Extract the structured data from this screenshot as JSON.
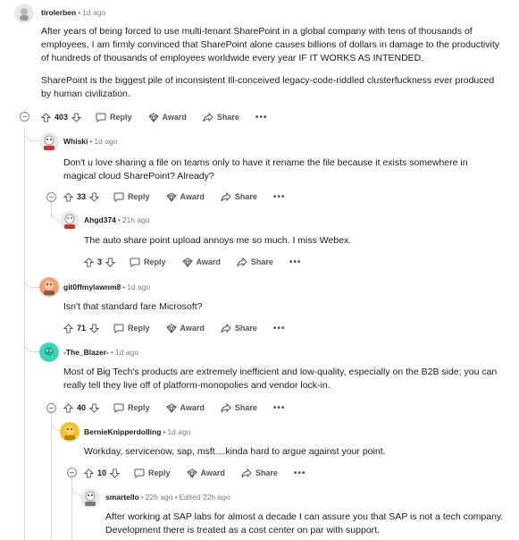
{
  "comments": [
    {
      "author": "tirolerben",
      "time": "1d ago",
      "body": [
        "After years of being forced to use multi-tenant SharePoint in a global company with tens of thousands of employees, I am firmly convinced that SharePoint alone causes billions of dollars in damage to the productivity of hundreds of thousands of employees worldwide every year IF IT WORKS AS INTENDED.",
        "SharePoint is the biggest pile of inconsistent Ill-conceived legacy-code-riddled clusterfuckness ever produced by human civilization."
      ],
      "votes": "403"
    },
    {
      "author": "Whiski",
      "time": "1d ago",
      "body": [
        "Don't u love sharing a file on teams only to have it rename the file because it exists somewhere in magical cloud SharePoint? Already?"
      ],
      "votes": "33"
    },
    {
      "author": "Ahgd374",
      "time": "21h ago",
      "body": [
        "The auto share point upload annoys me so much. I miss Webex."
      ],
      "votes": "3"
    },
    {
      "author": "git0ffmylawnm8",
      "time": "1d ago",
      "body": [
        "Isn't that standard fare Microsoft?"
      ],
      "votes": "71"
    },
    {
      "author": "-The_Blazer-",
      "time": "1d ago",
      "body": [
        "Most of Big Tech's products are extremely inefficient and low-quality, especially on the B2B side; you can really tell they live off of platform-monopolies and vendor lock-in."
      ],
      "votes": "40"
    },
    {
      "author": "BernieKnipperdolling",
      "time": "1d ago",
      "body": [
        "Workday, servicenow, sap, msft....kinda hard to argue against your point."
      ],
      "votes": "10"
    },
    {
      "author": "smartello",
      "time": "22h ago",
      "edited": "Edited 22h ago",
      "body": [
        "After working at SAP labs for almost a decade I can assure you that SAP is not a tech company. Development there is treated as a cost center on par with support."
      ]
    }
  ],
  "actions": {
    "reply": "Reply",
    "award": "Award",
    "share": "Share",
    "more": "•••",
    "dot": "•"
  },
  "colors": {
    "text": "#1c1c1c",
    "meta": "#7c7c7c",
    "thread_line": "#dadada",
    "avatar_tirolerben": "#d9d9d9",
    "avatar_git": "#f0a070",
    "avatar_blazer": "#3ad6b5",
    "avatar_bernie": "#f2c12e"
  }
}
